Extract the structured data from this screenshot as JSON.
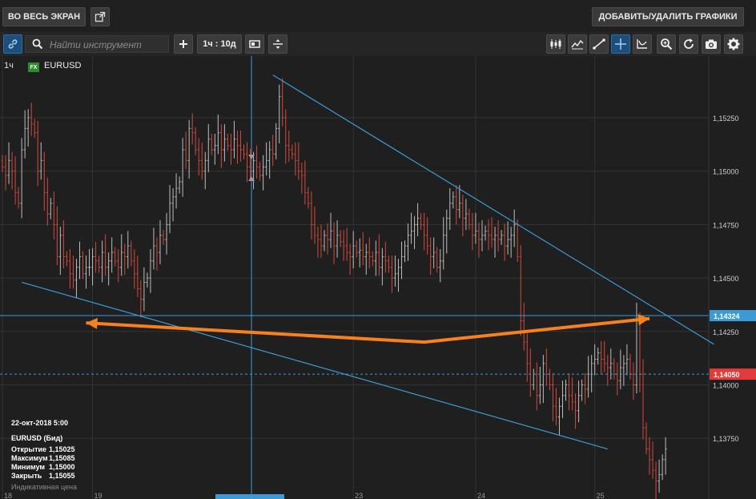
{
  "topbar": {
    "fullscreen_label": "ВО ВЕСЬ ЭКРАН",
    "add_remove_label": "ДОБАВИТЬ/УДАЛИТЬ ГРАФИКИ"
  },
  "toolbar": {
    "search_placeholder": "Найти инструмент",
    "timeframe_label": "1ч : 10д"
  },
  "instrument": {
    "timeframe": "1ч",
    "badge": "FX",
    "symbol": "EURUSD"
  },
  "info_panel": {
    "datetime": "22-окт-2018 5:00",
    "title": "EURUSD (Бид)",
    "rows": [
      {
        "label": "Открытие",
        "value": "1,15025"
      },
      {
        "label": "Максимум",
        "value": "1,15085"
      },
      {
        "label": "Минимум",
        "value": "1,15000"
      },
      {
        "label": "Закрыть",
        "value": "1,15055"
      }
    ],
    "note": "Индикативная цена"
  },
  "colors": {
    "background": "#1f1f1f",
    "grid": "#333333",
    "bull": "#bdbdbd",
    "bear": "#d24a3e",
    "trendline": "#3c9ad6",
    "arrow": "#f5821f",
    "crosshair_label": "#3c9ad6",
    "last_price_label": "#e33b3b"
  },
  "chart_data": {
    "type": "candlestick",
    "symbol": "EURUSD",
    "timeframe": "1ч",
    "ylim": [
      1.135,
      1.155
    ],
    "y_ticks": [
      "1,15250",
      "1,15000",
      "1,14750",
      "1,14500",
      "1,14250",
      "1,14000",
      "1,13750"
    ],
    "y_tick_values": [
      1.1525,
      1.15,
      1.1475,
      1.145,
      1.1425,
      1.14,
      1.1375
    ],
    "x_ticks": [
      "18",
      "19",
      "23",
      "24",
      "25"
    ],
    "x_tick_bar_index": [
      0,
      28,
      109,
      147,
      184
    ],
    "crosshair_price": "1,14324",
    "crosshair_value": 1.14324,
    "last_price": "1,14050",
    "last_price_value": 1.1405,
    "arrow_points": [
      {
        "bar": 26,
        "price": 1.1429
      },
      {
        "bar": 131,
        "price": 1.142
      },
      {
        "bar": 201,
        "price": 1.1431
      }
    ],
    "trendlines": [
      {
        "from": {
          "bar": 84,
          "price": 1.1545
        },
        "to": {
          "bar": 221,
          "price": 1.1419
        }
      },
      {
        "from": {
          "bar": 6,
          "price": 1.1448
        },
        "to": {
          "bar": 188,
          "price": 1.137
        }
      }
    ],
    "closes": [
      1.1502,
      1.1498,
      1.1505,
      1.15,
      1.149,
      1.1485,
      1.151,
      1.152,
      1.1525,
      1.1522,
      1.1518,
      1.15,
      1.1505,
      1.149,
      1.148,
      1.1485,
      1.1475,
      1.146,
      1.147,
      1.146,
      1.1458,
      1.1452,
      1.1449,
      1.1455,
      1.146,
      1.1452,
      1.1455,
      1.1455,
      1.146,
      1.1458,
      1.1455,
      1.1462,
      1.1455,
      1.1458,
      1.1462,
      1.1458,
      1.1455,
      1.1462,
      1.146,
      1.1465,
      1.1458,
      1.1452,
      1.1445,
      1.144,
      1.1448,
      1.145,
      1.1458,
      1.1465,
      1.1462,
      1.147,
      1.1468,
      1.1475,
      1.1485,
      1.1488,
      1.1492,
      1.1495,
      1.151,
      1.1505,
      1.152,
      1.1518,
      1.151,
      1.1505,
      1.15,
      1.1505,
      1.1515,
      1.151,
      1.1512,
      1.1518,
      1.151,
      1.1515,
      1.1512,
      1.151,
      1.1515,
      1.1512,
      1.151,
      1.1508,
      1.1502,
      1.15,
      1.1505,
      1.1502,
      1.1498,
      1.1502,
      1.1505,
      1.151,
      1.1508,
      1.152,
      1.1535,
      1.1525,
      1.1512,
      1.151,
      1.1508,
      1.1505,
      1.15,
      1.1498,
      1.149,
      1.1485,
      1.1475,
      1.147,
      1.1468,
      1.1465,
      1.147,
      1.1468,
      1.1472,
      1.1465,
      1.147,
      1.1467,
      1.1465,
      1.1462,
      1.146,
      1.1465,
      1.1462,
      1.1463,
      1.146,
      1.1462,
      1.146,
      1.1458,
      1.1462,
      1.1455,
      1.146,
      1.1458,
      1.1455,
      1.145,
      1.1452,
      1.1455,
      1.146,
      1.1465,
      1.147,
      1.1472,
      1.1475,
      1.1478,
      1.1475,
      1.147,
      1.1465,
      1.146,
      1.1462,
      1.1455,
      1.1458,
      1.147,
      1.1478,
      1.1485,
      1.1488,
      1.1482,
      1.1485,
      1.1478,
      1.148,
      1.1475,
      1.147,
      1.1472,
      1.1468,
      1.147,
      1.1472,
      1.147,
      1.1468,
      1.147,
      1.1468,
      1.147,
      1.1465,
      1.1468,
      1.147,
      1.1475,
      1.146,
      1.143,
      1.142,
      1.141,
      1.14,
      1.1405,
      1.1395,
      1.14,
      1.141,
      1.1405,
      1.14,
      1.139,
      1.1385,
      1.139,
      1.1395,
      1.14,
      1.1395,
      1.1392,
      1.1388,
      1.1395,
      1.14,
      1.1398,
      1.1405,
      1.141,
      1.1412,
      1.1415,
      1.1412,
      1.141,
      1.1408,
      1.141,
      1.1405,
      1.1402,
      1.1408,
      1.141,
      1.1412,
      1.1405,
      1.14,
      1.143,
      1.1405,
      1.138,
      1.137,
      1.1365,
      1.136,
      1.1355,
      1.1358,
      1.1365,
      1.137
    ]
  }
}
